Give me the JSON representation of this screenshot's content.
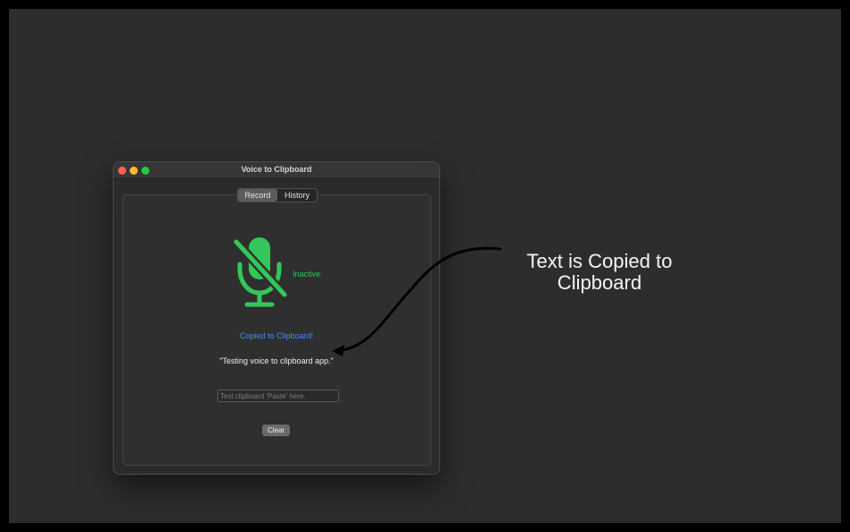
{
  "window": {
    "title": "Voice to Clipboard"
  },
  "tabs": [
    {
      "label": "Record",
      "selected": true
    },
    {
      "label": "History",
      "selected": false
    }
  ],
  "recorder": {
    "icon": "microphone-slash-icon",
    "status": "Inactive",
    "status_color": "#33c759",
    "copied_message": "Copied to Clipboard!",
    "copied_color": "#3f8cff",
    "transcript": "\"Testing voice to clipboard app.\"",
    "paste_field": {
      "placeholder": "Test clipboard 'Paste' here.",
      "value": ""
    },
    "clear_label": "Clear"
  },
  "annotation": {
    "text": "Text is Copied to Clipboard"
  }
}
